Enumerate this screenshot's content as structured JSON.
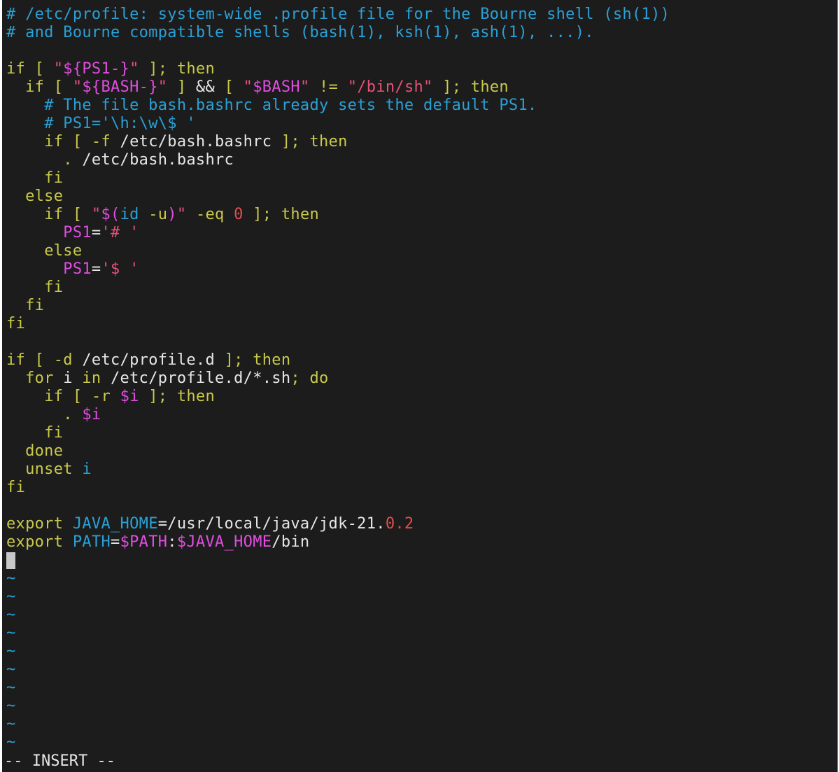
{
  "colors": {
    "default": "#e6e6e6",
    "comment": "#2aa0d6",
    "keyword": "#c9c94b",
    "string": "#e6517a",
    "variable": "#e04de0",
    "bracket": "#c9c94b",
    "number": "#e04e4e",
    "ident": "#2aa0d6",
    "tilde": "#2aa0d6"
  },
  "editor": {
    "lines": [
      [
        [
          "comment",
          "# /etc/profile: system-wide .profile file for the Bourne shell (sh(1))"
        ]
      ],
      [
        [
          "comment",
          "# and Bourne compatible shells (bash(1), ksh(1), ash(1), ...)."
        ]
      ],
      [],
      [
        [
          "keyword",
          "if"
        ],
        [
          "default",
          " "
        ],
        [
          "bracket",
          "["
        ],
        [
          "default",
          " "
        ],
        [
          "string",
          "\""
        ],
        [
          "variable",
          "${PS1-}"
        ],
        [
          "string",
          "\""
        ],
        [
          "default",
          " "
        ],
        [
          "bracket",
          "]"
        ],
        [
          "keyword",
          "; then"
        ]
      ],
      [
        [
          "default",
          "  "
        ],
        [
          "keyword",
          "if"
        ],
        [
          "default",
          " "
        ],
        [
          "bracket",
          "["
        ],
        [
          "default",
          " "
        ],
        [
          "string",
          "\""
        ],
        [
          "variable",
          "${BASH-}"
        ],
        [
          "string",
          "\""
        ],
        [
          "default",
          " "
        ],
        [
          "bracket",
          "]"
        ],
        [
          "default",
          " && "
        ],
        [
          "bracket",
          "["
        ],
        [
          "default",
          " "
        ],
        [
          "string",
          "\""
        ],
        [
          "variable",
          "$BASH"
        ],
        [
          "string",
          "\""
        ],
        [
          "default",
          " "
        ],
        [
          "keyword",
          "!="
        ],
        [
          "default",
          " "
        ],
        [
          "string",
          "\"/bin/sh\""
        ],
        [
          "default",
          " "
        ],
        [
          "bracket",
          "]"
        ],
        [
          "keyword",
          "; then"
        ]
      ],
      [
        [
          "default",
          "    "
        ],
        [
          "comment",
          "# The file bash.bashrc already sets the default PS1."
        ]
      ],
      [
        [
          "default",
          "    "
        ],
        [
          "comment",
          "# PS1='\\h:\\w\\$ '"
        ]
      ],
      [
        [
          "default",
          "    "
        ],
        [
          "keyword",
          "if"
        ],
        [
          "default",
          " "
        ],
        [
          "bracket",
          "["
        ],
        [
          "default",
          " "
        ],
        [
          "keyword",
          "-f"
        ],
        [
          "default",
          " /etc/bash.bashrc "
        ],
        [
          "bracket",
          "]"
        ],
        [
          "keyword",
          "; then"
        ]
      ],
      [
        [
          "default",
          "      "
        ],
        [
          "keyword",
          "."
        ],
        [
          "default",
          " /etc/bash.bashrc"
        ]
      ],
      [
        [
          "default",
          "    "
        ],
        [
          "keyword",
          "fi"
        ]
      ],
      [
        [
          "default",
          "  "
        ],
        [
          "keyword",
          "else"
        ]
      ],
      [
        [
          "default",
          "    "
        ],
        [
          "keyword",
          "if"
        ],
        [
          "default",
          " "
        ],
        [
          "bracket",
          "["
        ],
        [
          "default",
          " "
        ],
        [
          "string",
          "\""
        ],
        [
          "variable",
          "$("
        ],
        [
          "ident",
          "id"
        ],
        [
          "default",
          " "
        ],
        [
          "keyword",
          "-u"
        ],
        [
          "variable",
          ")"
        ],
        [
          "string",
          "\""
        ],
        [
          "default",
          " "
        ],
        [
          "keyword",
          "-eq"
        ],
        [
          "default",
          " "
        ],
        [
          "number",
          "0"
        ],
        [
          "default",
          " "
        ],
        [
          "bracket",
          "]"
        ],
        [
          "keyword",
          "; then"
        ]
      ],
      [
        [
          "default",
          "      "
        ],
        [
          "variable",
          "PS1"
        ],
        [
          "default",
          "="
        ],
        [
          "string",
          "'# '"
        ]
      ],
      [
        [
          "default",
          "    "
        ],
        [
          "keyword",
          "else"
        ]
      ],
      [
        [
          "default",
          "      "
        ],
        [
          "variable",
          "PS1"
        ],
        [
          "default",
          "="
        ],
        [
          "string",
          "'$ '"
        ]
      ],
      [
        [
          "default",
          "    "
        ],
        [
          "keyword",
          "fi"
        ]
      ],
      [
        [
          "default",
          "  "
        ],
        [
          "keyword",
          "fi"
        ]
      ],
      [
        [
          "keyword",
          "fi"
        ]
      ],
      [],
      [
        [
          "keyword",
          "if"
        ],
        [
          "default",
          " "
        ],
        [
          "bracket",
          "["
        ],
        [
          "default",
          " "
        ],
        [
          "keyword",
          "-d"
        ],
        [
          "default",
          " /etc/profile.d "
        ],
        [
          "bracket",
          "]"
        ],
        [
          "keyword",
          "; then"
        ]
      ],
      [
        [
          "default",
          "  "
        ],
        [
          "keyword",
          "for"
        ],
        [
          "default",
          " i "
        ],
        [
          "keyword",
          "in"
        ],
        [
          "default",
          " /etc/profile.d/*.sh"
        ],
        [
          "keyword",
          "; do"
        ]
      ],
      [
        [
          "default",
          "    "
        ],
        [
          "keyword",
          "if"
        ],
        [
          "default",
          " "
        ],
        [
          "bracket",
          "["
        ],
        [
          "default",
          " "
        ],
        [
          "keyword",
          "-r"
        ],
        [
          "default",
          " "
        ],
        [
          "variable",
          "$i"
        ],
        [
          "default",
          " "
        ],
        [
          "bracket",
          "]"
        ],
        [
          "keyword",
          "; then"
        ]
      ],
      [
        [
          "default",
          "      "
        ],
        [
          "keyword",
          "."
        ],
        [
          "default",
          " "
        ],
        [
          "variable",
          "$i"
        ]
      ],
      [
        [
          "default",
          "    "
        ],
        [
          "keyword",
          "fi"
        ]
      ],
      [
        [
          "default",
          "  "
        ],
        [
          "keyword",
          "done"
        ]
      ],
      [
        [
          "default",
          "  "
        ],
        [
          "keyword",
          "unset"
        ],
        [
          "default",
          " "
        ],
        [
          "ident",
          "i"
        ]
      ],
      [
        [
          "keyword",
          "fi"
        ]
      ],
      [],
      [
        [
          "keyword",
          "export"
        ],
        [
          "default",
          " "
        ],
        [
          "ident",
          "JAVA_HOME"
        ],
        [
          "default",
          "=/usr/local/java/jdk-21."
        ],
        [
          "number",
          "0.2"
        ]
      ],
      [
        [
          "keyword",
          "export"
        ],
        [
          "default",
          " "
        ],
        [
          "ident",
          "PATH"
        ],
        [
          "default",
          "="
        ],
        [
          "variable",
          "$PATH"
        ],
        [
          "default",
          ":"
        ],
        [
          "variable",
          "$JAVA_HOME"
        ],
        [
          "default",
          "/bin"
        ]
      ]
    ],
    "tilde_glyph": "~",
    "tilde_count": 10
  },
  "status_bar": {
    "mode": "-- INSERT --"
  }
}
